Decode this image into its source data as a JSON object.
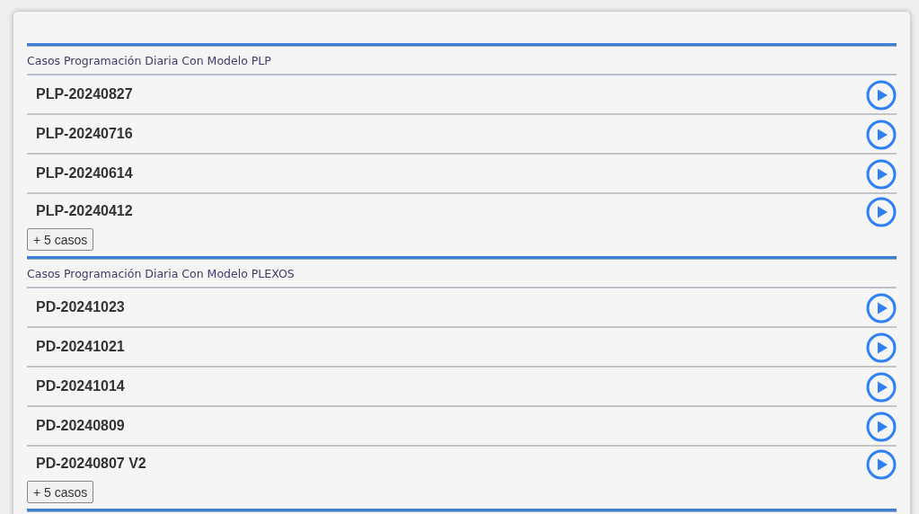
{
  "sections": [
    {
      "title": "Casos Programación Diaria Con Modelo PLP",
      "cases": [
        "PLP-20240827",
        "PLP-20240716",
        "PLP-20240614",
        "PLP-20240412"
      ],
      "more_button": "+ 5 casos"
    },
    {
      "title": "Casos Programación Diaria Con Modelo PLEXOS",
      "cases": [
        "PD-20241023",
        "PD-20241021",
        "PD-20241014",
        "PD-20240809",
        "PD-20240807 V2"
      ],
      "more_button": "+ 5 casos"
    }
  ]
}
